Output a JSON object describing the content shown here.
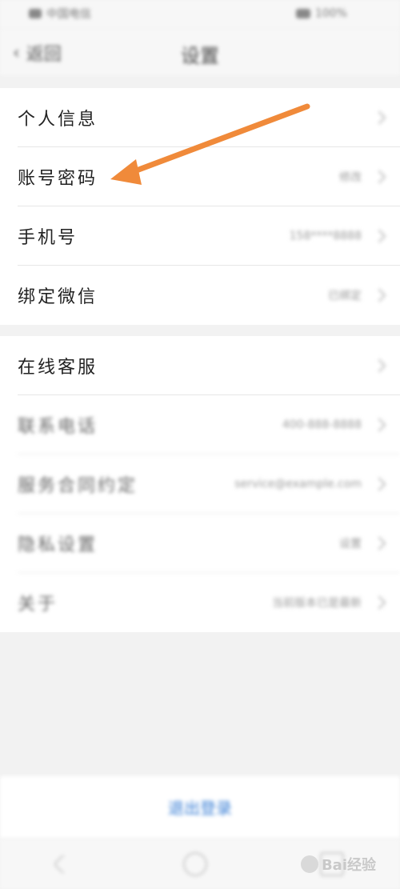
{
  "status_bar": {
    "carrier": "中国电信",
    "battery": "100%"
  },
  "nav": {
    "back_label": "返回",
    "title": "设置"
  },
  "section1": [
    {
      "label": "个人信息",
      "value": ""
    },
    {
      "label": "账号密码",
      "value": "修改"
    },
    {
      "label": "手机号",
      "value": "158****8888"
    },
    {
      "label": "绑定微信",
      "value": "已绑定"
    }
  ],
  "section2": [
    {
      "label": "在线客服",
      "value": ""
    },
    {
      "label": "联系电话",
      "value": "400-888-8888"
    },
    {
      "label": "服务合同约定",
      "value": "service@example.com"
    },
    {
      "label": "隐私设置",
      "value": "设置"
    },
    {
      "label": "关于",
      "value": "当前版本已是最新"
    }
  ],
  "footer": {
    "logout_label": "退出登录"
  },
  "watermark": {
    "text": "Bai经验"
  },
  "colors": {
    "arrow": "#f08a3a",
    "accent": "#3a7fd5"
  }
}
